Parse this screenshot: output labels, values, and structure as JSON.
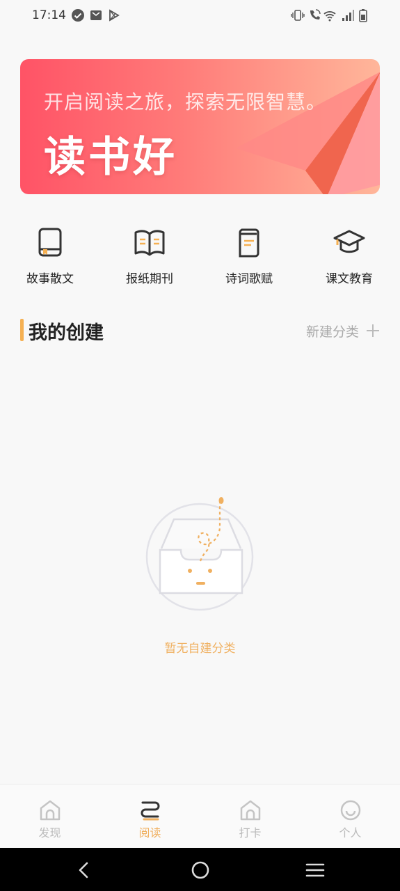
{
  "status": {
    "time": "17:14"
  },
  "banner": {
    "subtitle": "开启阅读之旅，探索无限智慧。",
    "title": "读书好"
  },
  "categories": [
    {
      "label": "故事散文",
      "icon": "book-icon"
    },
    {
      "label": "报纸期刊",
      "icon": "open-book-icon"
    },
    {
      "label": "诗词歌赋",
      "icon": "notebook-icon"
    },
    {
      "label": "课文教育",
      "icon": "graduation-cap-icon"
    }
  ],
  "section": {
    "title": "我的创建",
    "action": "新建分类"
  },
  "empty": {
    "text": "暂无自建分类"
  },
  "tabs": [
    {
      "label": "发现",
      "icon": "home-icon"
    },
    {
      "label": "阅读",
      "icon": "reading-icon"
    },
    {
      "label": "打卡",
      "icon": "checkin-icon"
    },
    {
      "label": "个人",
      "icon": "smiley-icon"
    }
  ],
  "colors": {
    "accent": "#f0b060",
    "banner_start": "#ff5366",
    "banner_end": "#ffb69a",
    "section_bar": "#f5b052"
  }
}
